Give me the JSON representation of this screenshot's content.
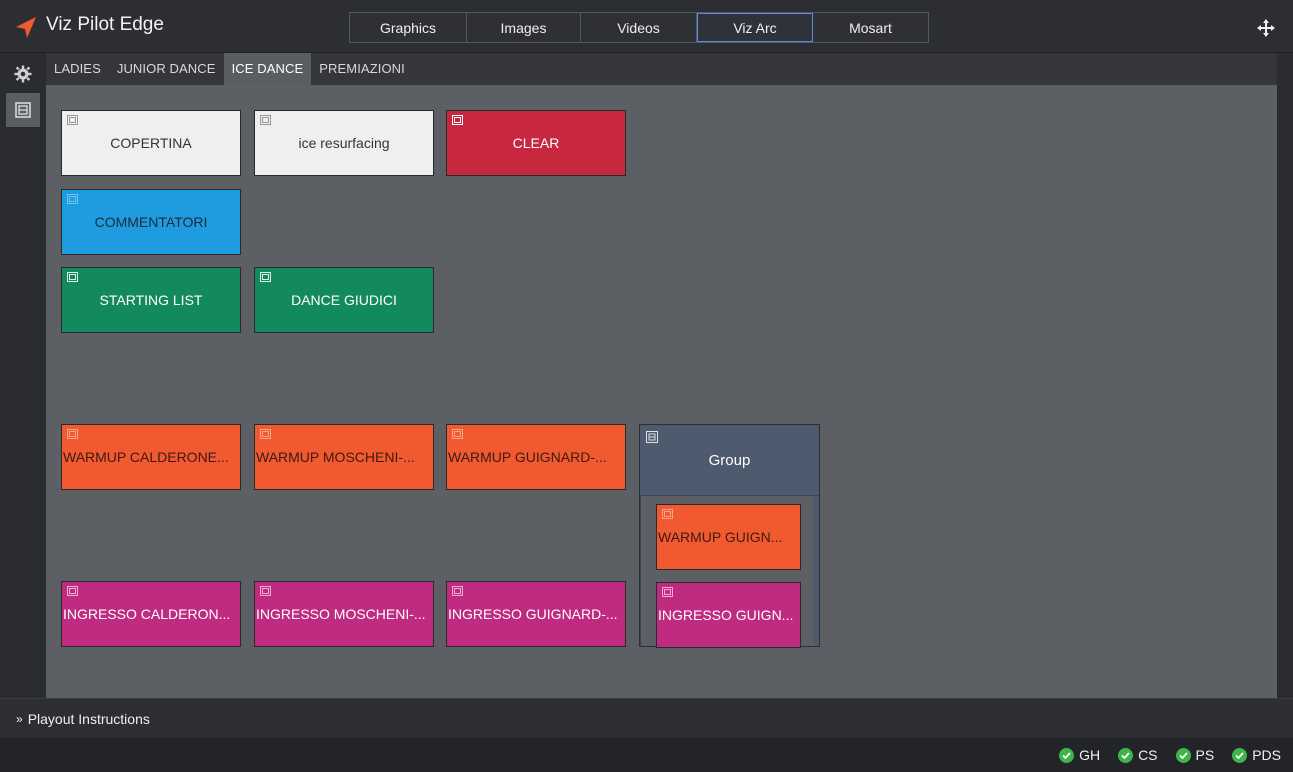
{
  "app": {
    "title": "Viz Pilot Edge",
    "accent": "#f15a31"
  },
  "top_tabs": [
    {
      "label": "Graphics",
      "active": false
    },
    {
      "label": "Images",
      "active": false
    },
    {
      "label": "Videos",
      "active": false
    },
    {
      "label": "Viz Arc",
      "active": true
    },
    {
      "label": "Mosart",
      "active": false
    }
  ],
  "sub_tabs": [
    {
      "label": "LADIES",
      "active": false
    },
    {
      "label": "JUNIOR DANCE",
      "active": false
    },
    {
      "label": "ICE DANCE",
      "active": true
    },
    {
      "label": "PREMIAZIONI",
      "active": false
    }
  ],
  "buttons": {
    "copertina": "COPERTINA",
    "ice_resurfacing": "ice resurfacing",
    "clear": "CLEAR",
    "commentatori": "COMMENTATORI",
    "starting_list": "STARTING LIST",
    "dance_giudici": "DANCE GIUDICI",
    "warmup_calderone": "WARMUP CALDERONE...",
    "warmup_moscheni": "WARMUP MOSCHENI-...",
    "warmup_guignard": "WARMUP GUIGNARD-...",
    "ingresso_calderon": "INGRESSO CALDERON...",
    "ingresso_moscheni": "INGRESSO MOSCHENI-...",
    "ingresso_guignard": "INGRESSO GUIGNARD-..."
  },
  "group": {
    "label": "Group",
    "items": [
      "WARMUP GUIGN...",
      "INGRESSO GUIGN..."
    ]
  },
  "playout": {
    "label": "Playout Instructions"
  },
  "status": [
    "GH",
    "CS",
    "PS",
    "PDS"
  ],
  "colors": {
    "white": "#efefef",
    "red": "#c8283f",
    "blue": "#1f9be0",
    "green": "#138a5e",
    "orange": "#f15a31",
    "magenta": "#c02b82",
    "group": "#4e5a6e",
    "ok": "#3db548"
  }
}
